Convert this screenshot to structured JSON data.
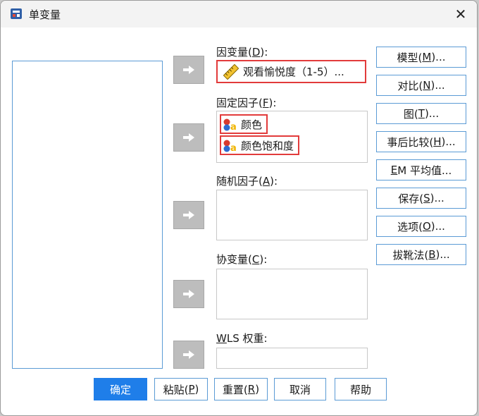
{
  "window": {
    "title": "单变量",
    "close_glyph": "✕"
  },
  "dependent": {
    "label_main": "因变量(",
    "label_key": "D",
    "label_tail": "):",
    "value": "观看愉悦度（1-5）..."
  },
  "fixed": {
    "label_main": "固定因子(",
    "label_key": "F",
    "label_tail": "):",
    "items": [
      {
        "label": "颜色"
      },
      {
        "label": "颜色饱和度"
      }
    ]
  },
  "random": {
    "label_main": "随机因子(",
    "label_key": "A",
    "label_tail": "):"
  },
  "covariate": {
    "label_main": "协变量(",
    "label_key": "C",
    "label_tail": "):"
  },
  "wls": {
    "label_key": "W",
    "label_main": "LS 权重:"
  },
  "side_buttons": [
    {
      "main": "模型(",
      "key": "M",
      "tail": ")..."
    },
    {
      "main": "对比(",
      "key": "N",
      "tail": ")..."
    },
    {
      "main": "图(",
      "key": "T",
      "tail": ")..."
    },
    {
      "main": "事后比较(",
      "key": "H",
      "tail": ")..."
    },
    {
      "main": "",
      "key": "E",
      "tail": "M 平均值..."
    },
    {
      "main": "保存(",
      "key": "S",
      "tail": ")..."
    },
    {
      "main": "选项(",
      "key": "O",
      "tail": ")..."
    },
    {
      "main": "拔靴法(",
      "key": "B",
      "tail": ")..."
    }
  ],
  "bottom_buttons": {
    "ok": "确定",
    "paste": {
      "main": "粘贴(",
      "key": "P",
      "tail": ")"
    },
    "reset": {
      "main": "重置(",
      "key": "R",
      "tail": ")"
    },
    "cancel": "取消",
    "help": "帮助"
  },
  "colors": {
    "accent": "#1f7ee9",
    "highlight": "#e23b3b",
    "list_border": "#5b9bd5"
  }
}
